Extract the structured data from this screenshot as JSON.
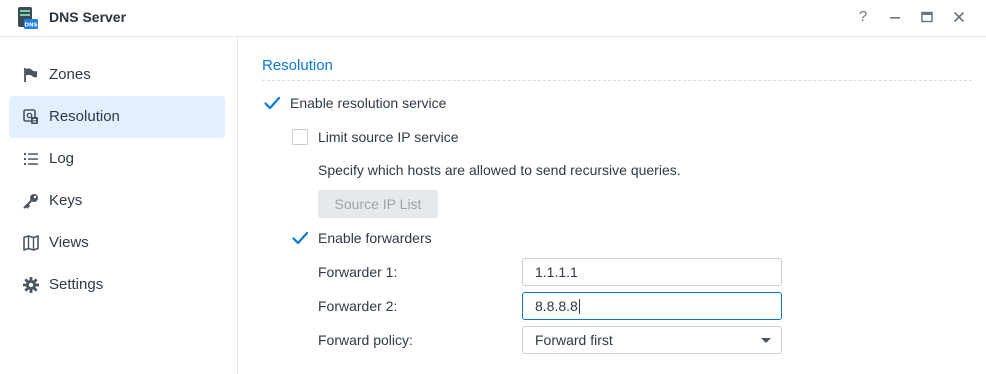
{
  "window": {
    "title": "DNS Server",
    "app_icon_text": "DNS",
    "controls": [
      "?",
      "minimize",
      "maximize",
      "close"
    ]
  },
  "sidebar": {
    "items": [
      {
        "label": "Zones",
        "icon": "flag-icon",
        "active": false
      },
      {
        "label": "Resolution",
        "icon": "resolution-icon",
        "active": true
      },
      {
        "label": "Log",
        "icon": "list-icon",
        "active": false
      },
      {
        "label": "Keys",
        "icon": "key-icon",
        "active": false
      },
      {
        "label": "Views",
        "icon": "map-icon",
        "active": false
      },
      {
        "label": "Settings",
        "icon": "gear-icon",
        "active": false
      }
    ]
  },
  "main": {
    "section_title": "Resolution",
    "enable_resolution": {
      "label": "Enable resolution service",
      "checked": true
    },
    "limit_source_ip": {
      "label": "Limit source IP service",
      "checked": false
    },
    "limit_description": "Specify which hosts are allowed to send recursive queries.",
    "source_ip_button": "Source IP List",
    "enable_forwarders": {
      "label": "Enable forwarders",
      "checked": true
    },
    "forwarder1": {
      "label": "Forwarder 1:",
      "value": "1.1.1.1"
    },
    "forwarder2": {
      "label": "Forwarder 2:",
      "value": "8.8.8.8"
    },
    "forward_policy": {
      "label": "Forward policy:",
      "value": "Forward first"
    }
  },
  "colors": {
    "accent": "#0a79d1",
    "active_nav_bg": "#e1efff",
    "text": "#2f3a45"
  }
}
